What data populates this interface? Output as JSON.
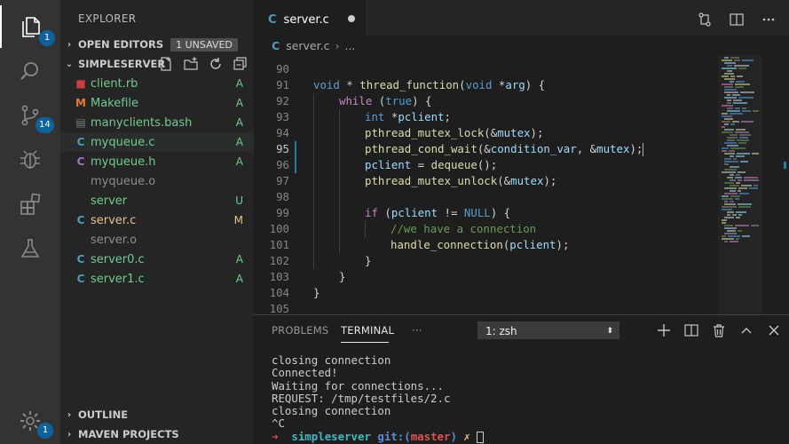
{
  "activity_bar": {
    "explorer_badge": "1",
    "scm_badge": "14",
    "accounts_badge": "1"
  },
  "sidebar": {
    "title": "EXPLORER",
    "open_editors": {
      "label": "OPEN EDITORS",
      "badge": "1 UNSAVED"
    },
    "folder": {
      "label": "SIMPLESERVER"
    },
    "files": [
      {
        "name": "client.rb",
        "status": "A",
        "icon": "ruby-icon",
        "color": "#73c991"
      },
      {
        "name": "Makefile",
        "status": "A",
        "icon": "makefile-icon",
        "color": "#73c991"
      },
      {
        "name": "manyclients.bash",
        "status": "A",
        "icon": "shell-icon",
        "color": "#73c991"
      },
      {
        "name": "myqueue.c",
        "status": "A",
        "icon": "c-file-icon",
        "color": "#73c991"
      },
      {
        "name": "myqueue.h",
        "status": "A",
        "icon": "h-file-icon",
        "color": "#73c991"
      },
      {
        "name": "myqueue.o",
        "status": "",
        "icon": "object-file-icon",
        "color": "#8c8c8c"
      },
      {
        "name": "server",
        "status": "U",
        "icon": "binary-file-icon",
        "color": "#73c991"
      },
      {
        "name": "server.c",
        "status": "M",
        "icon": "c-file-icon",
        "color": "#e2c08d"
      },
      {
        "name": "server.o",
        "status": "",
        "icon": "object-file-icon",
        "color": "#8c8c8c"
      },
      {
        "name": "server0.c",
        "status": "A",
        "icon": "c-file-icon",
        "color": "#73c991"
      },
      {
        "name": "server1.c",
        "status": "A",
        "icon": "c-file-icon",
        "color": "#73c991"
      }
    ],
    "outline": {
      "label": "OUTLINE"
    },
    "maven": {
      "label": "MAVEN PROJECTS"
    }
  },
  "editor": {
    "tab": {
      "label": "server.c",
      "icon_letter": "C"
    },
    "breadcrumb": {
      "file": "server.c",
      "more": "..."
    },
    "lines": [
      {
        "n": "90",
        "ind": 0,
        "tokens": []
      },
      {
        "n": "91",
        "ind": 0,
        "tokens": [
          [
            "kw",
            "void"
          ],
          [
            "p",
            " * "
          ],
          [
            "fn",
            "thread_function"
          ],
          [
            "p",
            "("
          ],
          [
            "kw",
            "void"
          ],
          [
            "p",
            " *"
          ],
          [
            "var",
            "arg"
          ],
          [
            "p",
            ") {"
          ]
        ]
      },
      {
        "n": "92",
        "ind": 1,
        "tokens": [
          [
            "ctl",
            "while"
          ],
          [
            "p",
            " ("
          ],
          [
            "kw",
            "true"
          ],
          [
            "p",
            ") {"
          ]
        ]
      },
      {
        "n": "93",
        "ind": 2,
        "tokens": [
          [
            "kw",
            "int"
          ],
          [
            "p",
            " *"
          ],
          [
            "var",
            "pclient"
          ],
          [
            "p",
            ";"
          ]
        ]
      },
      {
        "n": "94",
        "ind": 2,
        "tokens": [
          [
            "fn",
            "pthread_mutex_lock"
          ],
          [
            "p",
            "(&"
          ],
          [
            "var",
            "mutex"
          ],
          [
            "p",
            ");"
          ]
        ]
      },
      {
        "n": "95",
        "ind": 2,
        "tokens": [
          [
            "fn",
            "pthread_cond_wait"
          ],
          [
            "p",
            "(&"
          ],
          [
            "var",
            "condition_var"
          ],
          [
            "p",
            ", &"
          ],
          [
            "var",
            "mutex"
          ],
          [
            "p",
            ");"
          ]
        ]
      },
      {
        "n": "96",
        "ind": 2,
        "tokens": [
          [
            "var",
            "pclient"
          ],
          [
            "p",
            " = "
          ],
          [
            "fn",
            "dequeue"
          ],
          [
            "p",
            "();"
          ]
        ]
      },
      {
        "n": "97",
        "ind": 2,
        "tokens": [
          [
            "fn",
            "pthread_mutex_unlock"
          ],
          [
            "p",
            "(&"
          ],
          [
            "var",
            "mutex"
          ],
          [
            "p",
            ");"
          ]
        ]
      },
      {
        "n": "98",
        "ind": 2,
        "tokens": []
      },
      {
        "n": "99",
        "ind": 2,
        "tokens": [
          [
            "ctl",
            "if"
          ],
          [
            "p",
            " ("
          ],
          [
            "var",
            "pclient"
          ],
          [
            "p",
            " != "
          ],
          [
            "kw",
            "NULL"
          ],
          [
            "p",
            ") {"
          ]
        ]
      },
      {
        "n": "100",
        "ind": 3,
        "tokens": [
          [
            "cm",
            "//we have a connection"
          ]
        ]
      },
      {
        "n": "101",
        "ind": 3,
        "tokens": [
          [
            "fn",
            "handle_connection"
          ],
          [
            "p",
            "("
          ],
          [
            "var",
            "pclient"
          ],
          [
            "p",
            ");"
          ]
        ]
      },
      {
        "n": "102",
        "ind": 2,
        "tokens": [
          [
            "p",
            "}"
          ]
        ]
      },
      {
        "n": "103",
        "ind": 1,
        "tokens": [
          [
            "p",
            "}"
          ]
        ]
      },
      {
        "n": "104",
        "ind": 0,
        "tokens": [
          [
            "p",
            "}"
          ]
        ]
      },
      {
        "n": "105",
        "ind": 0,
        "tokens": []
      }
    ],
    "current_line": "95"
  },
  "panel": {
    "tabs": {
      "problems": "PROBLEMS",
      "terminal": "TERMINAL",
      "more": "···"
    },
    "terminal_select": "1: zsh",
    "terminal_lines": [
      "closing connection",
      "Connected!",
      "Waiting for connections...",
      "REQUEST: /tmp/testfiles/2.c",
      "closing connection",
      "^C"
    ],
    "prompt": {
      "arrow": "➜",
      "dir": "simpleserver",
      "git": "git:(",
      "branch": "master",
      "git_close": ")",
      "dirty": "✗"
    }
  },
  "colors": {
    "accent": "#0e639c",
    "added": "#73c991",
    "modified": "#e2c08d"
  }
}
